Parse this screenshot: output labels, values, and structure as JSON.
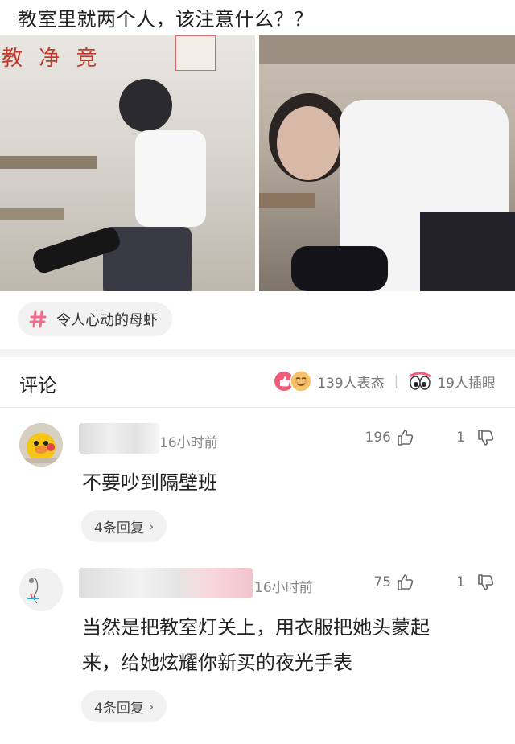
{
  "post": {
    "title": "教室里就两个人，该注意什么？？",
    "photo_banner_text": "教 净 竞"
  },
  "topic": {
    "label": "令人心动的母虾"
  },
  "comments_section": {
    "heading": "评论",
    "reactions_count": "139人表态",
    "separator": "|",
    "poke_count": "19人插眼"
  },
  "comments": [
    {
      "time": "16小时前",
      "like_count": "196",
      "dislike_count": "1",
      "text": "不要吵到隔壁班",
      "replies_label": "4条回复"
    },
    {
      "time": "16小时前",
      "like_count": "75",
      "dislike_count": "1",
      "text_line1": "当然是把教室灯关上，用衣服把她头蒙起",
      "text_line2": "来，给她炫耀你新买的夜光手表",
      "replies_label": "4条回复"
    }
  ],
  "colors": {
    "topic_hash": "#f06a8a",
    "like_icon_bg": "#f25c7a",
    "smile_icon_bg": "#f6c36a"
  }
}
